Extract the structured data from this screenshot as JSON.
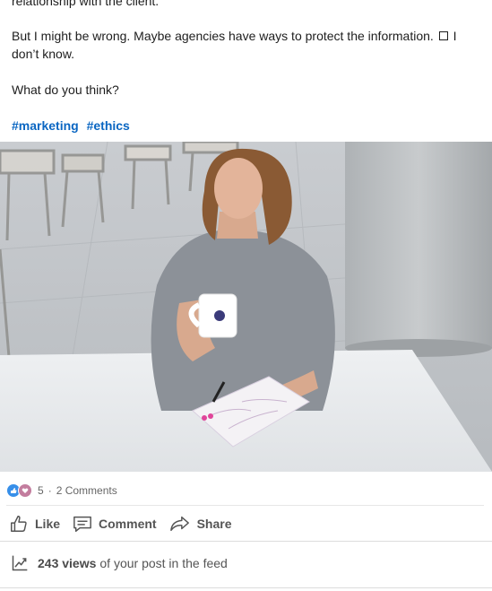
{
  "post": {
    "cut_line": "relationship with the client.",
    "paragraph1_a": "But I might be wrong. Maybe agencies have ways to protect the information.",
    "paragraph1_b": "I don’t know.",
    "paragraph2": "What do you think?",
    "hashtags": [
      "#marketing",
      "#ethics"
    ]
  },
  "image": {
    "description_icon": "photo-woman-with-mug"
  },
  "social": {
    "reaction_count": "5",
    "separator": "·",
    "comments": "2 Comments"
  },
  "actions": {
    "like": "Like",
    "comment": "Comment",
    "share": "Share"
  },
  "views": {
    "count": "243 views",
    "suffix": "of your post in the feed"
  },
  "colors": {
    "hashtag": "#0a66c2",
    "like_reaction": "#378fe9"
  }
}
